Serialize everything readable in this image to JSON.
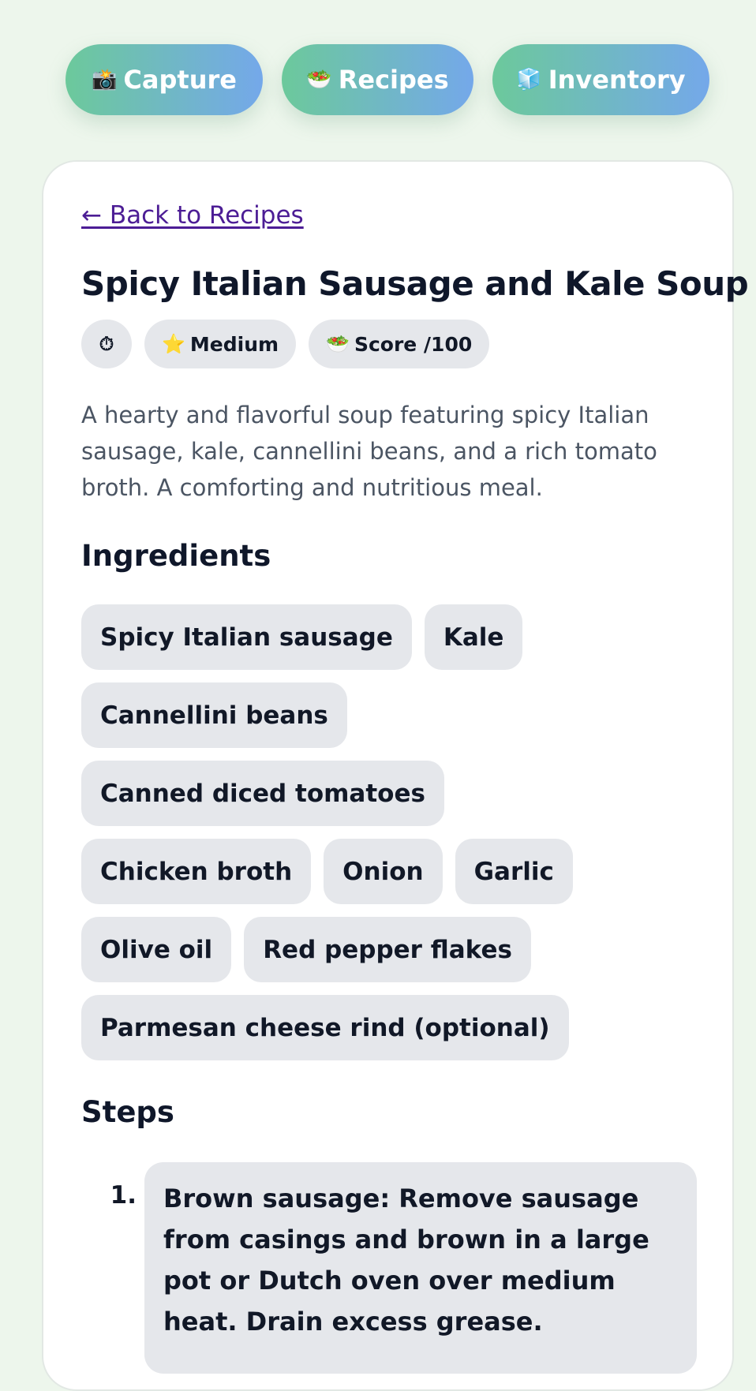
{
  "nav": [
    {
      "icon": "📸",
      "icon_name": "camera-flash-icon",
      "label": "Capture"
    },
    {
      "icon": "🥗",
      "icon_name": "salad-icon",
      "label": "Recipes"
    },
    {
      "icon": "🧊",
      "icon_name": "ice-cube-icon",
      "label": "Inventory"
    }
  ],
  "back_link": "← Back to Recipes",
  "recipe": {
    "title": "Spicy Italian Sausage and Kale Soup",
    "badges": {
      "timer_icon": "⏱",
      "difficulty_icon": "⭐",
      "difficulty": "Medium",
      "score_icon": "🥗",
      "score": "Score /100"
    },
    "description": "A hearty and flavorful soup featuring spicy Italian sausage, kale, cannellini beans, and a rich tomato broth. A comforting and nutritious meal.",
    "ingredients_heading": "Ingredients",
    "ingredients": [
      "Spicy Italian sausage",
      "Kale",
      "Cannellini beans",
      "Canned diced tomatoes",
      "Chicken broth",
      "Onion",
      "Garlic",
      "Olive oil",
      "Red pepper flakes",
      "Parmesan cheese rind (optional)"
    ],
    "steps_heading": "Steps",
    "steps": [
      {
        "number": "1.",
        "text": "Brown sausage: Remove sausage from casings and brown in a large pot or Dutch oven over medium heat. Drain excess grease."
      }
    ]
  },
  "colors": {
    "page_bg": "#edf6ec",
    "nav_gradient_start": "#6cc99b",
    "nav_gradient_end": "#74a8ea",
    "link": "#4c1d95",
    "chip_bg": "#e5e7eb",
    "heading": "#0f172a",
    "body_text": "#4b5563"
  }
}
